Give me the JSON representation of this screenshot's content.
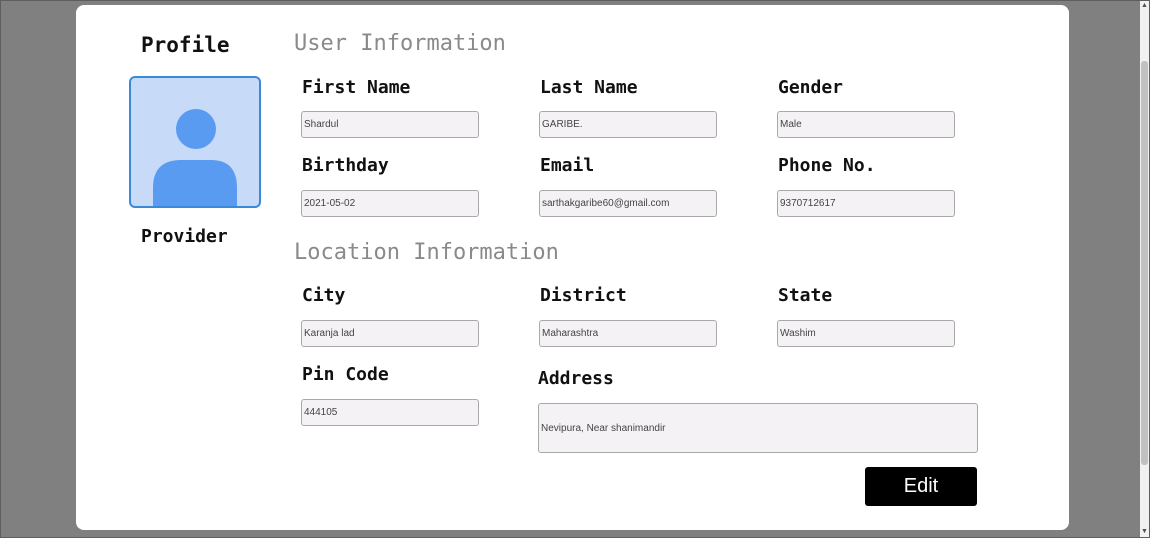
{
  "profile": {
    "title": "Profile",
    "role": "Provider",
    "avatar_icon": "user-avatar-icon",
    "avatar_bg": "#c7daf8",
    "avatar_fg": "#5a9bf2"
  },
  "user_info": {
    "section_title": "User Information",
    "first_name": {
      "label": "First Name",
      "value": "Shardul"
    },
    "last_name": {
      "label": "Last Name",
      "value": "GARIBE."
    },
    "gender": {
      "label": "Gender",
      "value": "Male"
    },
    "birthday": {
      "label": "Birthday",
      "value": "2021-05-02"
    },
    "email": {
      "label": "Email",
      "value": "sarthakgaribe60@gmail.com"
    },
    "phone": {
      "label": "Phone No.",
      "value": "9370712617"
    }
  },
  "location_info": {
    "section_title": "Location Information",
    "city": {
      "label": "City",
      "value": "Karanja lad"
    },
    "district": {
      "label": "District",
      "value": "Maharashtra"
    },
    "state": {
      "label": "State",
      "value": "Washim"
    },
    "pin_code": {
      "label": "Pin Code",
      "value": "444105"
    },
    "address": {
      "label": "Address",
      "value": "Nevipura, Near shanimandir"
    }
  },
  "actions": {
    "edit_label": "Edit"
  }
}
